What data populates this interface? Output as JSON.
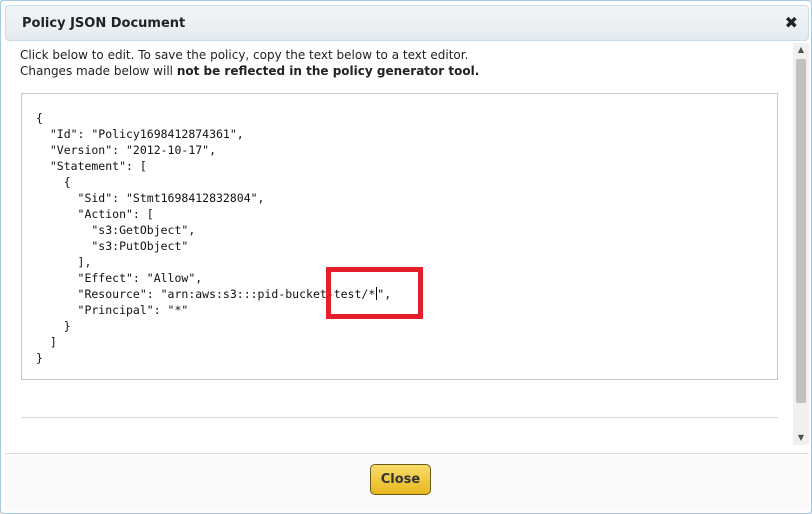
{
  "dialog": {
    "title": "Policy JSON Document",
    "close_icon": "close-icon",
    "close_glyph": "✖"
  },
  "intro": {
    "line1": "Click below to edit. To save the policy, copy the text below to a text editor.",
    "line2_prefix": "Changes made below will ",
    "line2_bold": "not be reflected in the policy generator tool."
  },
  "editor": {
    "lines": [
      "{",
      "  \"Id\": \"Policy1698412874361\",",
      "  \"Version\": \"2012-10-17\",",
      "  \"Statement\": [",
      "    {",
      "      \"Sid\": \"Stmt1698412832804\",",
      "      \"Action\": [",
      "        \"s3:GetObject\",",
      "        \"s3:PutObject\"",
      "      ],",
      "      \"Effect\": \"Allow\",",
      "      \"Resource\": \"arn:aws:s3:::pid-bucket-test/*",
      "      \"Principal\": \"*\"",
      "    }",
      "  ]",
      "}"
    ],
    "caret_suffix": "\","
  },
  "footer": {
    "close_label": "Close"
  },
  "colors": {
    "highlight": "#e61e2a",
    "button": "#f0c843"
  }
}
